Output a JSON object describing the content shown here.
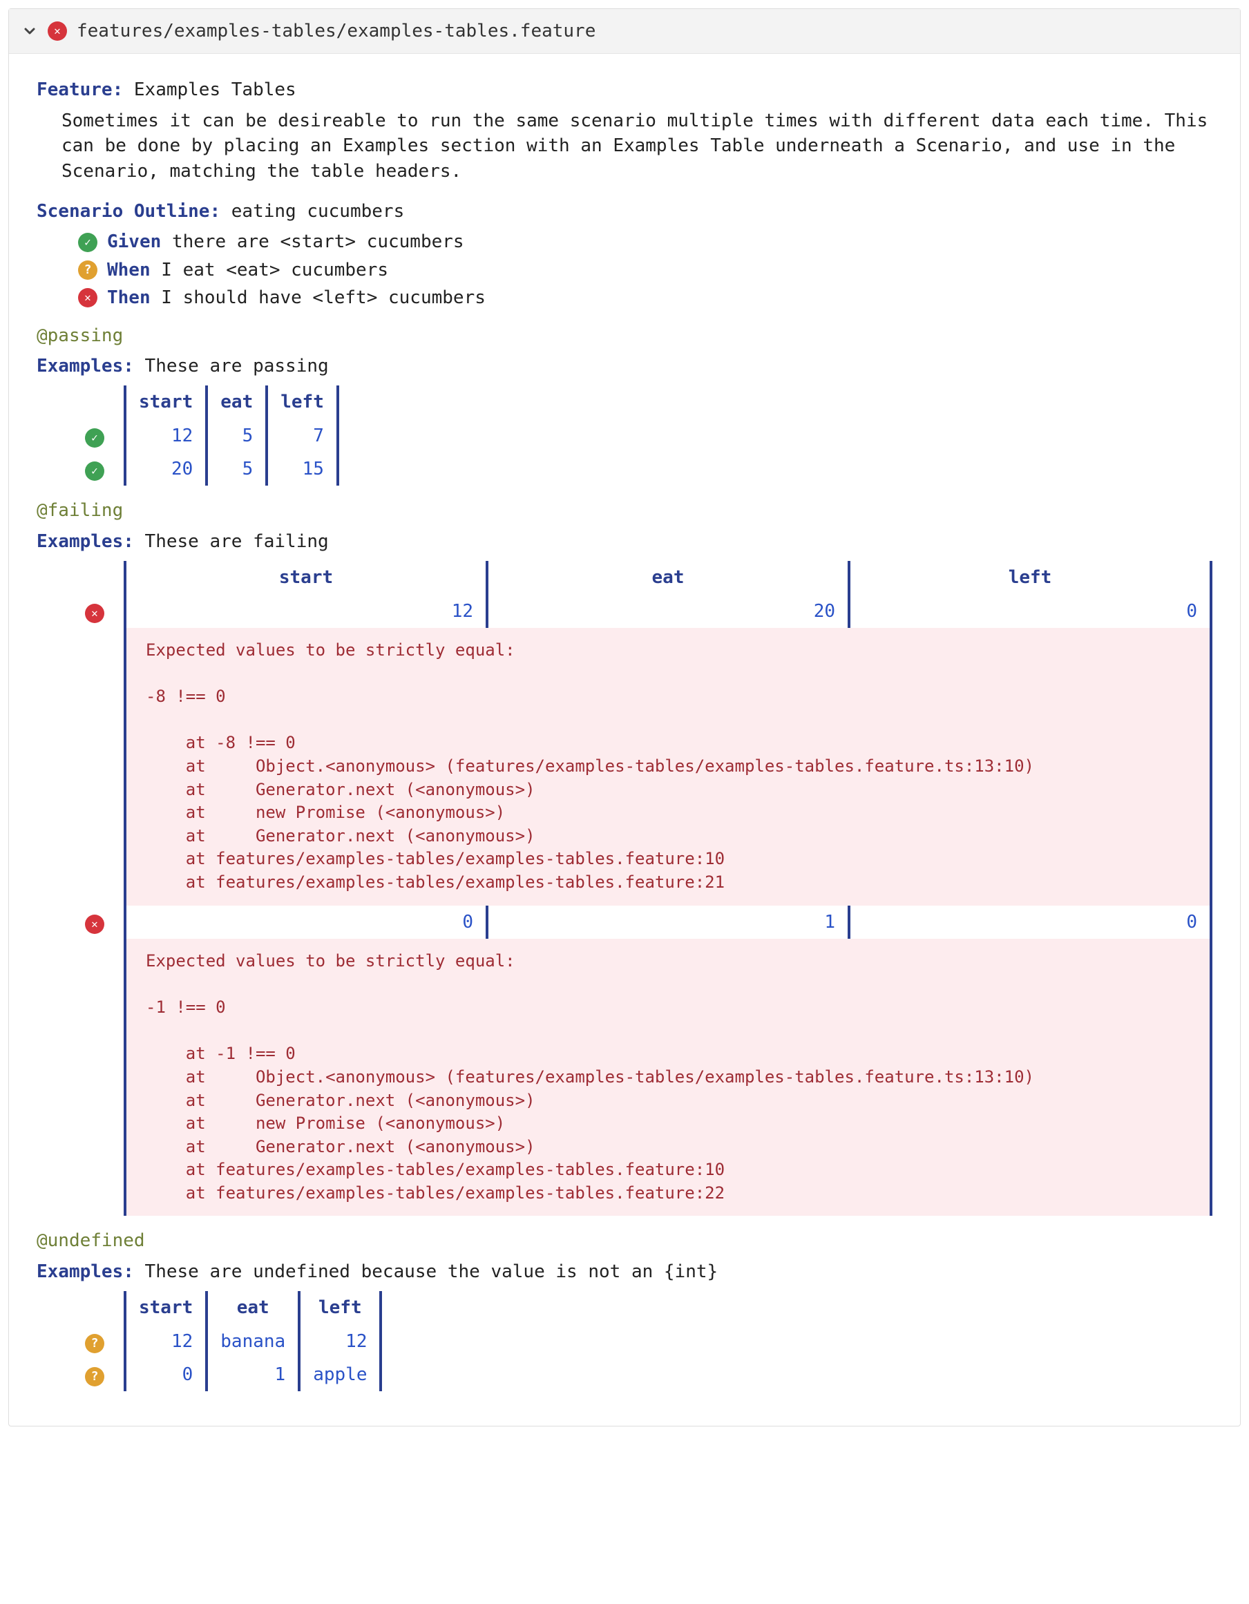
{
  "file_path": "features/examples-tables/examples-tables.feature",
  "feature": {
    "keyword": "Feature:",
    "title": "Examples Tables",
    "description": "Sometimes it can be desireable to run the same scenario multiple times with different data each time. This can be done by placing an Examples section with an Examples Table underneath a Scenario, and use in the Scenario, matching the table headers."
  },
  "scenario": {
    "keyword": "Scenario Outline:",
    "title": "eating cucumbers",
    "steps": [
      {
        "status": "pass",
        "keyword": "Given",
        "text": "there are <start> cucumbers"
      },
      {
        "status": "unknown",
        "keyword": "When",
        "text": "I eat <eat> cucumbers"
      },
      {
        "status": "fail",
        "keyword": "Then",
        "text": "I should have <left> cucumbers"
      }
    ]
  },
  "examples": [
    {
      "tag": "@passing",
      "keyword": "Examples:",
      "title": "These are passing",
      "headers": [
        "start",
        "eat",
        "left"
      ],
      "rows": [
        {
          "status": "pass",
          "values": [
            "12",
            "5",
            "7"
          ]
        },
        {
          "status": "pass",
          "values": [
            "20",
            "5",
            "15"
          ]
        }
      ]
    },
    {
      "tag": "@failing",
      "keyword": "Examples:",
      "title": "These are failing",
      "headers": [
        "start",
        "eat",
        "left"
      ],
      "full_width": true,
      "rows": [
        {
          "status": "fail",
          "values": [
            "12",
            "20",
            "0"
          ],
          "error": "Expected values to be strictly equal:\n\n-8 !== 0\n\n    at -8 !== 0\n    at     Object.<anonymous> (features/examples-tables/examples-tables.feature.ts:13:10)\n    at     Generator.next (<anonymous>)\n    at     new Promise (<anonymous>)\n    at     Generator.next (<anonymous>)\n    at features/examples-tables/examples-tables.feature:10\n    at features/examples-tables/examples-tables.feature:21"
        },
        {
          "status": "fail",
          "values": [
            "0",
            "1",
            "0"
          ],
          "error": "Expected values to be strictly equal:\n\n-1 !== 0\n\n    at -1 !== 0\n    at     Object.<anonymous> (features/examples-tables/examples-tables.feature.ts:13:10)\n    at     Generator.next (<anonymous>)\n    at     new Promise (<anonymous>)\n    at     Generator.next (<anonymous>)\n    at features/examples-tables/examples-tables.feature:10\n    at features/examples-tables/examples-tables.feature:22"
        }
      ]
    },
    {
      "tag": "@undefined",
      "keyword": "Examples:",
      "title": "These are undefined because the value is not an {int}",
      "headers": [
        "start",
        "eat",
        "left"
      ],
      "rows": [
        {
          "status": "unknown",
          "values": [
            "12",
            "banana",
            "12"
          ]
        },
        {
          "status": "unknown",
          "values": [
            "0",
            "1",
            "apple"
          ]
        }
      ]
    }
  ]
}
